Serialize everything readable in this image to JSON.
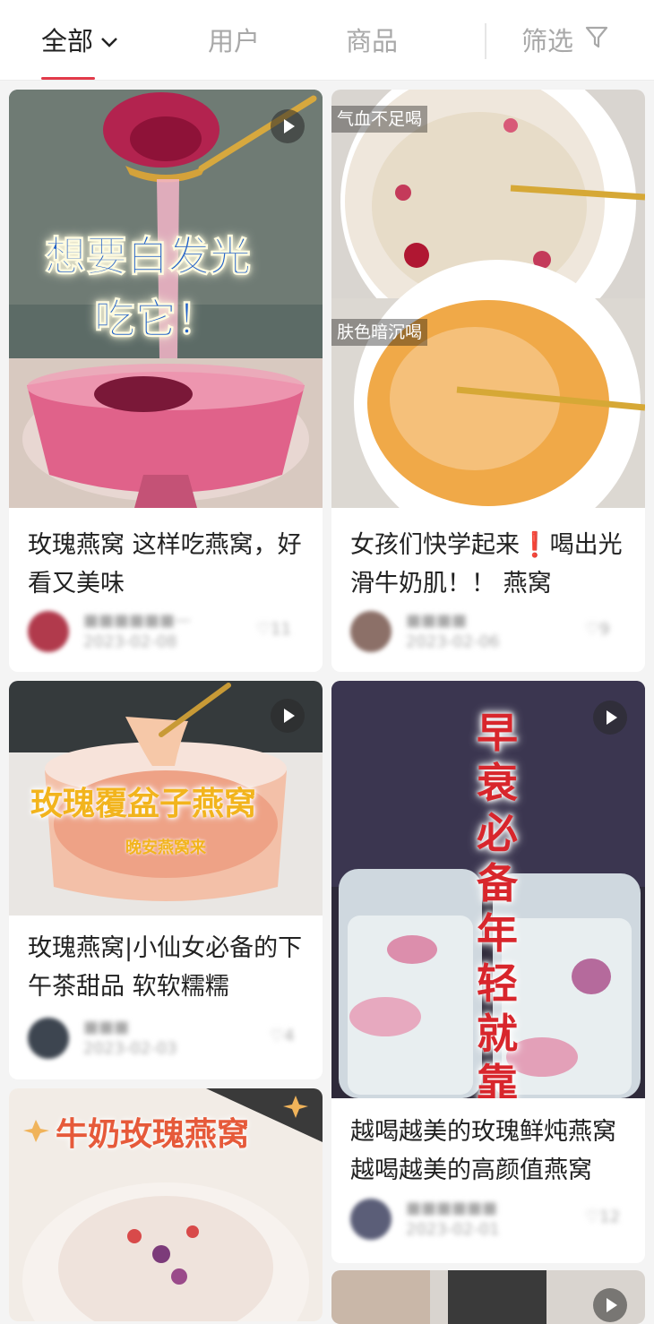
{
  "tabs": {
    "all": "全部",
    "users": "用户",
    "products": "商品",
    "filter": "筛选"
  },
  "colors": {
    "accent": "#e23a4a",
    "active_text": "#222222",
    "inactive_text": "#a8a8a8"
  },
  "cards": [
    {
      "title": "玫瑰燕窝 这样吃燕窝，好看又美味",
      "overlay_lines": [
        "想要白发光",
        "吃它！"
      ],
      "has_video": true,
      "author": "■■■■■■—",
      "date": "2023-02-08",
      "likes": "11"
    },
    {
      "title": "女孩们快学起来❗喝出光滑牛奶肌！！ 燕窝",
      "tags": [
        "气血不足喝",
        "肤色暗沉喝"
      ],
      "has_video": false,
      "author": "■■■■",
      "date": "2023-02-06",
      "likes": "9"
    },
    {
      "title": "玫瑰燕窝|小仙女必备的下午茶甜品 软软糯糯",
      "overlay_lines": [
        "玫瑰覆盆子燕窝",
        "晚安燕窝来"
      ],
      "has_video": true,
      "author": "■■■",
      "date": "2023-02-03",
      "likes": "4"
    },
    {
      "title": "越喝越美的玫瑰鲜炖燕窝 越喝越美的高颜值燕窝",
      "overlay_lines": [
        "早衰必备年轻就靠它"
      ],
      "has_video": true,
      "author": "■■■■■■",
      "date": "2023-02-01",
      "likes": "12"
    },
    {
      "title": "",
      "overlay_lines": [
        "牛奶玫瑰燕窝"
      ],
      "has_video": false
    },
    {
      "title": "",
      "has_video": true
    }
  ],
  "icons": {
    "dropdown": "chevron-down-icon",
    "filter": "funnel-icon",
    "video": "play-icon",
    "like": "heart-icon"
  }
}
